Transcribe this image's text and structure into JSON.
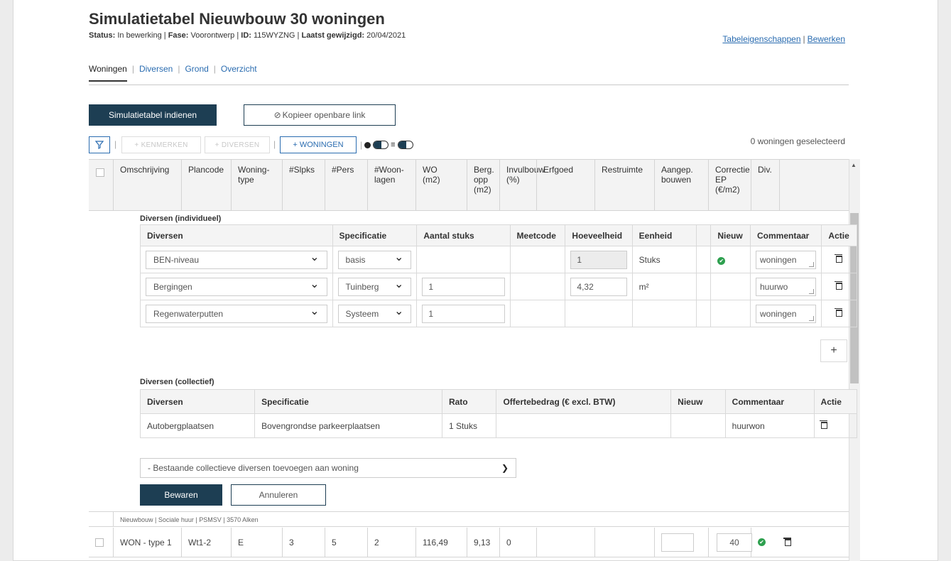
{
  "header": {
    "title": "Simulatietabel Nieuwbouw 30 woningen",
    "status_label": "Status:",
    "status_value": "In bewerking",
    "fase_label": "Fase:",
    "fase_value": "Voorontwerp",
    "id_label": "ID:",
    "id_value": "115WYZNG",
    "changed_label": "Laatst gewijzigd:",
    "changed_value": "20/04/2021",
    "sep": "|",
    "link_props": "Tabeleigenschappen",
    "link_edit": "Bewerken"
  },
  "tabs": [
    "Woningen",
    "Diversen",
    "Grond",
    "Overzicht"
  ],
  "actions": {
    "submit": "Simulatietabel indienen",
    "copy": "Kopieer openbare link",
    "copy_icon": "link-icon"
  },
  "toolbar": {
    "kenmerken": "+ KENMERKEN",
    "diversen": "+ DIVERSEN",
    "woningen": "+ WONINGEN",
    "filter_icon": "filter-icon",
    "info_icon": "info-icon",
    "list_icon": "list-icon",
    "selected": "0 woningen geselecteerd"
  },
  "main_columns": [
    {
      "label": "Omschrijving"
    },
    {
      "label": "Plancode"
    },
    {
      "label": "Woning-\ntype"
    },
    {
      "label": "#Slpks"
    },
    {
      "label": "#Pers"
    },
    {
      "label": "#Woon-\nlagen"
    },
    {
      "label": "WO\n(m2)"
    },
    {
      "label": "Berg.\nopp\n(m2)"
    },
    {
      "label": "Invulbouw\n(%)"
    },
    {
      "label": "Erfgoed"
    },
    {
      "label": "Restruimte"
    },
    {
      "label": "Aangep.\nbouwen"
    },
    {
      "label": "Correctie\nEP\n(€/m2)"
    },
    {
      "label": "Div."
    }
  ],
  "individueel": {
    "title": "Diversen (individueel)",
    "headers": [
      "Diversen",
      "Specificatie",
      "Aantal stuks",
      "Meetcode",
      "Hoeveelheid",
      "Eenheid",
      "",
      "Nieuw",
      "Commentaar",
      "Actie"
    ],
    "rows": [
      {
        "diversen": "BEN-niveau",
        "spec": "basis",
        "aantal": "",
        "meetcode": "",
        "hoeveelheid": "1",
        "eenheid": "Stuks",
        "nieuw": true,
        "commentaar": "woningen"
      },
      {
        "diversen": "Bergingen",
        "spec": "Tuinberg",
        "aantal": "1",
        "meetcode": "",
        "hoeveelheid": "4,32",
        "eenheid": "m²",
        "nieuw": false,
        "commentaar": "huurwo"
      },
      {
        "diversen": "Regenwaterputten",
        "spec": "Systeem",
        "aantal": "1",
        "meetcode": "",
        "hoeveelheid": "",
        "eenheid": "",
        "nieuw": false,
        "commentaar": "woningen"
      }
    ],
    "add": "+"
  },
  "collectief": {
    "title": "Diversen (collectief)",
    "headers": [
      "Diversen",
      "Specificatie",
      "Rato",
      "Offertebedrag (€ excl. BTW)",
      "Nieuw",
      "Commentaar",
      "Actie"
    ],
    "rows": [
      {
        "diversen": "Autobergplaatsen",
        "spec": "Bovengrondse parkeerplaatsen",
        "rato": "1 Stuks",
        "offerte": "",
        "nieuw": "",
        "commentaar": "huurwon"
      }
    ],
    "select_placeholder": "- Bestaande collectieve diversen toevoegen aan woning"
  },
  "form": {
    "save": "Bewaren",
    "cancel": "Annuleren"
  },
  "group_row": "Nieuwbouw | Sociale huur | PSMSV | 3570 Alken",
  "data_row": {
    "omschrijving": "WON - type 1",
    "plancode": "Wt1-2",
    "type": "E",
    "slpks": "3",
    "pers": "5",
    "woonlagen": "2",
    "wo": "116,49",
    "berg": "9,13",
    "invul": "0",
    "correctie": "40"
  }
}
